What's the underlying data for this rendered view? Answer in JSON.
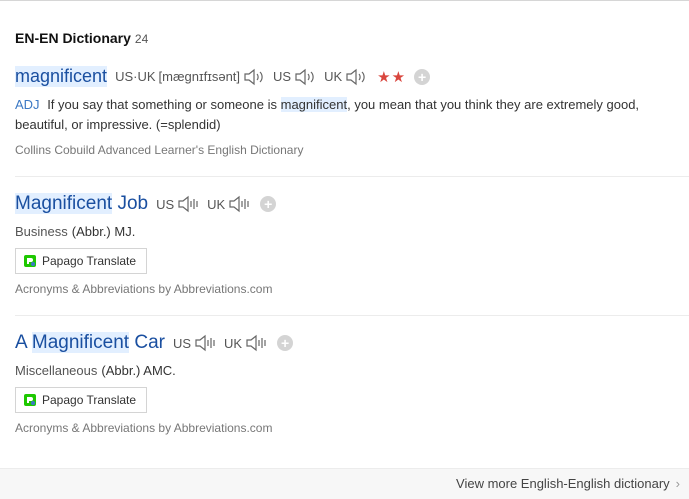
{
  "section": {
    "title": "EN-EN Dictionary",
    "count": "24"
  },
  "entries": [
    {
      "word": "magnificent",
      "pron_label": "US·UK",
      "phonetic": "[mægnɪfɪsənt]",
      "us_label": "US",
      "uk_label": "UK",
      "stars": "★★",
      "pos": "ADJ",
      "def_pre": "If you say that something or someone is",
      "def_hl": "magnificent",
      "def_post": ", you mean that you think they are extremely good, beautiful, or impressive. (=splendid)",
      "source": "Collins Cobuild Advanced Learner's English Dictionary"
    },
    {
      "word_hl": "Magnificent",
      "word_rest": "Job",
      "us_label": "US",
      "uk_label": "UK",
      "category": "Business",
      "abbr": "(Abbr.) MJ.",
      "papago": "Papago Translate",
      "source": "Acronyms & Abbreviations by Abbreviations.com"
    },
    {
      "word_pre": "A",
      "word_hl": "Magnificent",
      "word_rest": "Car",
      "us_label": "US",
      "uk_label": "UK",
      "category": "Miscellaneous",
      "abbr": "(Abbr.) AMC.",
      "papago": "Papago Translate",
      "source": "Acronyms & Abbreviations by Abbreviations.com"
    }
  ],
  "footer": {
    "view_more": "View more English-English dictionary"
  },
  "colors": {
    "link": "#1a4fa0",
    "highlight": "#e2efff",
    "star": "#d9463e"
  }
}
